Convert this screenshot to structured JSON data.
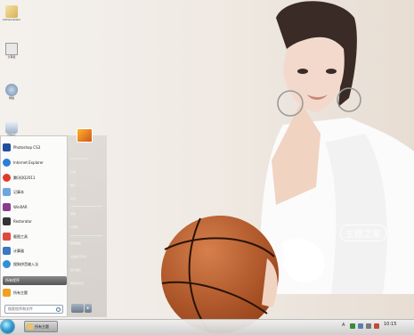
{
  "desktop": {
    "icons": [
      {
        "label": "Administrator",
        "icon": "user-folder-icon"
      },
      {
        "label": "计算机",
        "icon": "computer-icon"
      },
      {
        "label": "网络",
        "icon": "network-icon"
      },
      {
        "label": "回收站",
        "icon": "recycle-bin-icon"
      }
    ],
    "watermark": "主题之家"
  },
  "start_menu": {
    "programs": [
      {
        "label": "Photoshop CS3",
        "icon": "photoshop-icon",
        "color": "#1e4f9c"
      },
      {
        "label": "Internet Explorer",
        "icon": "ie-icon",
        "color": "#2c7ed6"
      },
      {
        "label": "腾讯QQ2011",
        "icon": "qq-icon",
        "color": "#e23a2a"
      },
      {
        "label": "记事本",
        "icon": "notepad-icon",
        "color": "#6aa7e0"
      },
      {
        "label": "WinRAR",
        "icon": "winrar-icon",
        "color": "#8b3a8b"
      },
      {
        "label": "Restorator",
        "icon": "restorator-icon",
        "color": "#333333"
      },
      {
        "label": "截图工具",
        "icon": "snipping-icon",
        "color": "#e04a3a"
      },
      {
        "label": "计算器",
        "icon": "calculator-icon",
        "color": "#3a78c2"
      },
      {
        "label": "搜狗拼音输入法",
        "icon": "sogou-icon",
        "color": "#2f8fd8"
      },
      {
        "label": "所有主题",
        "icon": "themes-icon",
        "color": "#f0a020"
      }
    ],
    "all_programs": "所有程序",
    "search_placeholder": "搜索程序和文件",
    "right_links": [
      "Administrator",
      "文档",
      "图片",
      "音乐",
      "游戏",
      "计算机",
      "控制面板",
      "设备和打印机",
      "默认程序",
      "帮助和支持"
    ]
  },
  "taskbar": {
    "active_window": "所有主题",
    "tray_icons": [
      "input-method-icon",
      "network-icon",
      "volume-icon",
      "flag-icon"
    ],
    "tray_letter": "A",
    "clock": "10:15"
  }
}
